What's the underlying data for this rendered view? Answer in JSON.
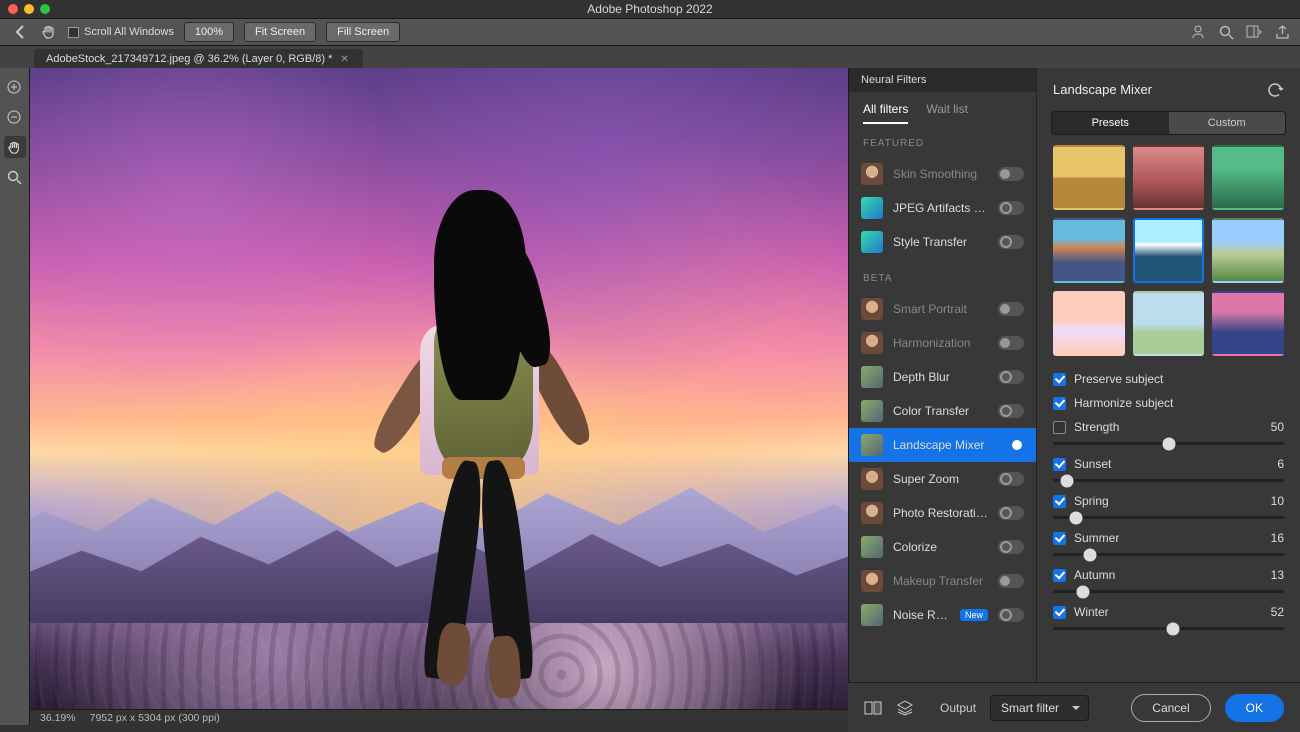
{
  "app_title": "Adobe Photoshop 2022",
  "optionsbar": {
    "scroll_all_label": "Scroll All Windows",
    "zoom_pct": "100%",
    "fit_screen": "Fit Screen",
    "fill_screen": "Fill Screen"
  },
  "document_tab": "AdobeStock_217349712.jpeg @ 36.2% (Layer 0, RGB/8) *",
  "statusbar": {
    "zoom": "36.19%",
    "docinfo": "7952 px x 5304 px (300 ppi)"
  },
  "neural_filters": {
    "panel_label": "Neural Filters",
    "tabs": {
      "all": "All filters",
      "wait": "Wait list"
    },
    "sections": {
      "featured": "FEATURED",
      "beta": "BETA"
    },
    "featured": [
      {
        "name": "Skin Smoothing",
        "on": false,
        "dim": true,
        "thumb": "face"
      },
      {
        "name": "JPEG Artifacts Rem...",
        "on": false,
        "ring": true,
        "thumb": "abstract"
      },
      {
        "name": "Style Transfer",
        "on": false,
        "ring": true,
        "thumb": "abstract"
      }
    ],
    "beta": [
      {
        "name": "Smart Portrait",
        "on": false,
        "dim": true,
        "thumb": "face"
      },
      {
        "name": "Harmonization",
        "on": false,
        "dim": true,
        "thumb": "face"
      },
      {
        "name": "Depth Blur",
        "on": false,
        "ring": true,
        "thumb": "land"
      },
      {
        "name": "Color Transfer",
        "on": false,
        "ring": true,
        "thumb": "land"
      },
      {
        "name": "Landscape Mixer",
        "on": true,
        "selected": true,
        "thumb": "land"
      },
      {
        "name": "Super Zoom",
        "on": false,
        "ring": true,
        "thumb": "face"
      },
      {
        "name": "Photo Restoration",
        "on": false,
        "ring": true,
        "thumb": "face"
      },
      {
        "name": "Colorize",
        "on": false,
        "ring": true,
        "thumb": "land"
      },
      {
        "name": "Makeup Transfer",
        "on": false,
        "dim": true,
        "thumb": "face"
      },
      {
        "name": "Noise Reduct...",
        "on": false,
        "ring": true,
        "thumb": "land",
        "badge": "New"
      }
    ]
  },
  "mixer": {
    "title": "Landscape Mixer",
    "tabs": {
      "presets": "Presets",
      "custom": "Custom"
    },
    "selected_preset_index": 4,
    "checks": {
      "preserve": {
        "label": "Preserve subject",
        "on": true
      },
      "harmonize": {
        "label": "Harmonize subject",
        "on": true
      }
    },
    "sliders": [
      {
        "key": "strength",
        "label": "Strength",
        "value": 50,
        "check": false,
        "checked": false
      },
      {
        "key": "sunset",
        "label": "Sunset",
        "value": 6,
        "check": true,
        "checked": true
      },
      {
        "key": "spring",
        "label": "Spring",
        "value": 10,
        "check": true,
        "checked": true
      },
      {
        "key": "summer",
        "label": "Summer",
        "value": 16,
        "check": true,
        "checked": true
      },
      {
        "key": "autumn",
        "label": "Autumn",
        "value": 13,
        "check": true,
        "checked": true
      },
      {
        "key": "winter",
        "label": "Winter",
        "value": 52,
        "check": true,
        "checked": true
      }
    ]
  },
  "actions": {
    "output_label": "Output",
    "output_value": "Smart filter",
    "cancel": "Cancel",
    "ok": "OK"
  }
}
